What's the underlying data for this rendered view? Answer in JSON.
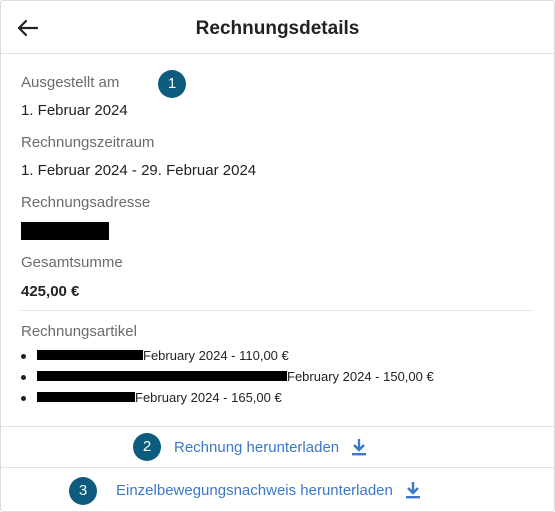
{
  "header": {
    "title": "Rechnungsdetails",
    "back_icon": "arrow-left-icon"
  },
  "fields": {
    "issued": {
      "label": "Ausgestellt am",
      "value": "1. Februar 2024"
    },
    "period": {
      "label": "Rechnungszeitraum",
      "value": "1. Februar 2024 - 29. Februar 2024"
    },
    "address": {
      "label": "Rechnungsadresse",
      "value": ""
    },
    "total": {
      "label": "Gesamtsumme",
      "value": "425,00 €"
    }
  },
  "items_section": {
    "label": "Rechnungsartikel",
    "items": [
      {
        "text": "February 2024 - 110,00 €"
      },
      {
        "text": "February 2024 - 150,00 €"
      },
      {
        "text": "February 2024 - 165,00 €"
      }
    ]
  },
  "actions": {
    "download_invoice": {
      "label": "Rechnung herunterladen",
      "icon": "download-icon"
    },
    "download_itemized": {
      "label": "Einzelbewegungsnachweis herunterladen",
      "icon": "download-icon"
    }
  },
  "badges": [
    "1",
    "2",
    "3"
  ],
  "colors": {
    "badge": "#0d5b7e",
    "link": "#3a78c9",
    "label": "#6b6b6b",
    "redaction": "#000000"
  }
}
